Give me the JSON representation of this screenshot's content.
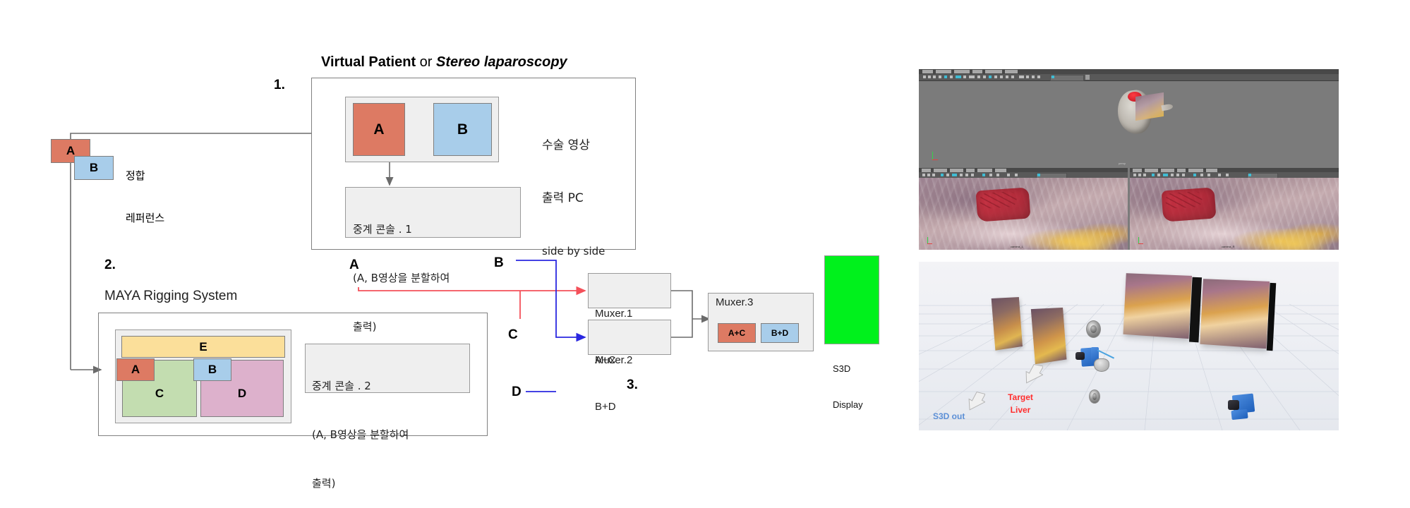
{
  "diagram": {
    "steps": {
      "one": "1.",
      "two": "2.",
      "three": "3."
    },
    "title": {
      "virtual_patient": "Virtual Patient",
      "or": " or ",
      "stereo_laparoscopy": "Stereo laparoscopy"
    },
    "reference": {
      "a_label": "A",
      "b_label": "B",
      "caption_line1": "정합",
      "caption_line2": "레퍼런스"
    },
    "block1": {
      "a_label": "A",
      "b_label": "B",
      "side_text_line1": "수술 영상",
      "side_text_line2": "출력 PC",
      "side_text_line3": "side by side",
      "console": {
        "line1": "중계 콘솔 . 1",
        "line2": "(A, B영상을 분할하여",
        "line3": "출력)"
      }
    },
    "block2": {
      "system_title": "MAYA Rigging System",
      "e_label": "E",
      "a_label": "A",
      "b_label": "B",
      "c_label": "C",
      "d_label": "D",
      "console": {
        "line1": "중계 콘솔 . 2",
        "line2": "(A, B영상을 분할하여",
        "line3": "출력)"
      }
    },
    "signals": {
      "a": "A",
      "b": "B",
      "c": "C",
      "d": "D"
    },
    "muxers": {
      "m1": {
        "title": "Muxer.1",
        "sub": "A+C"
      },
      "m2": {
        "title": "Muxer.2",
        "sub": "B+D"
      },
      "m3": {
        "title": "Muxer.3",
        "cell_left": "A+C",
        "cell_right": "B+D"
      }
    },
    "display": {
      "line1": "S3D",
      "line2": "Display"
    },
    "colors": {
      "red_cell": "#dd7a63",
      "blue_cell": "#a8cdea",
      "green_cell": "#c3ddb0",
      "yellow_cell": "#fbdf9a",
      "pink_cell": "#ddb1cc",
      "display_green": "#00f11c",
      "red_arrow": "#f4505a",
      "blue_arrow": "#2a27e0",
      "grey_arrow": "#6b6b6b",
      "box_border": "#808080",
      "panel_fill": "#efefef"
    }
  },
  "screenshots": {
    "top": {
      "name": "maya-stereo-viewports",
      "viewport_menu": [
        "View",
        "Shading",
        "Lighting",
        "Show",
        "Renderer",
        "Panels"
      ],
      "left_view_label": "persp",
      "cam_left_label": "camera_L",
      "cam_right_label": "camera_R"
    },
    "bottom": {
      "name": "maya-scene-layout",
      "labels": {
        "target_liver": {
          "line1": "Target",
          "line2": "Liver",
          "color": "#ff2d2d"
        },
        "s3d_out": {
          "text": "S3D out",
          "color": "#5b8fd6"
        }
      }
    }
  }
}
